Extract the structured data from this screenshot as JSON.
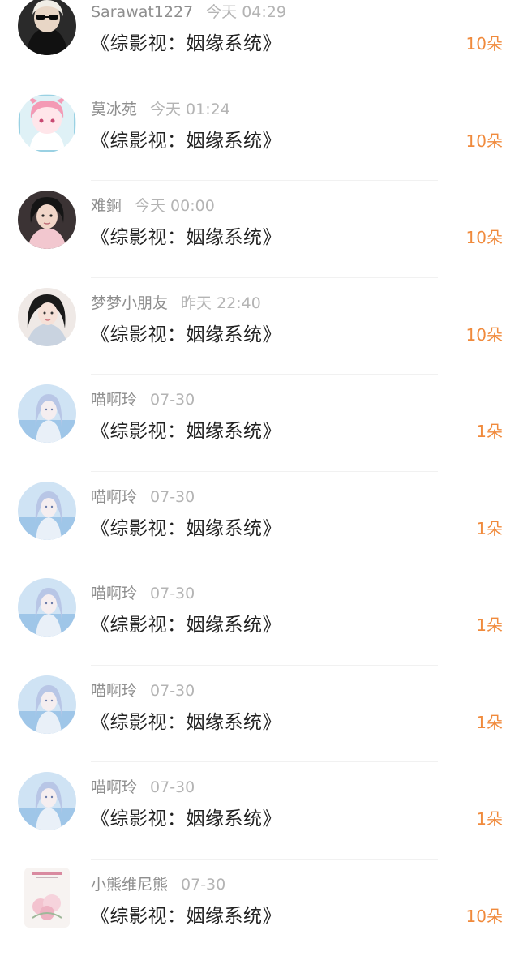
{
  "accent_color": "#f08a3c",
  "items": [
    {
      "name": "Sarawat1227",
      "time": "今天 04:29",
      "title": "《综影视：姻缘系统》",
      "gift": "10朵",
      "avatar": "dark-sunglasses-portrait"
    },
    {
      "name": "莫冰苑",
      "time": "今天 01:24",
      "title": "《综影视：姻缘系统》",
      "gift": "10朵",
      "avatar": "pink-anime-character"
    },
    {
      "name": "难錒",
      "time": "今天 00:00",
      "title": "《综影视：姻缘系统》",
      "gift": "10朵",
      "avatar": "girl-portrait-dark"
    },
    {
      "name": "梦梦小朋友",
      "time": "昨天 22:40",
      "title": "《综影视：姻缘系统》",
      "gift": "10朵",
      "avatar": "girl-portrait-light"
    },
    {
      "name": "喵啊玲",
      "time": "07-30",
      "title": "《综影视：姻缘系统》",
      "gift": "1朵",
      "avatar": "blue-anime-girl"
    },
    {
      "name": "喵啊玲",
      "time": "07-30",
      "title": "《综影视：姻缘系统》",
      "gift": "1朵",
      "avatar": "blue-anime-girl"
    },
    {
      "name": "喵啊玲",
      "time": "07-30",
      "title": "《综影视：姻缘系统》",
      "gift": "1朵",
      "avatar": "blue-anime-girl"
    },
    {
      "name": "喵啊玲",
      "time": "07-30",
      "title": "《综影视：姻缘系统》",
      "gift": "1朵",
      "avatar": "blue-anime-girl"
    },
    {
      "name": "喵啊玲",
      "time": "07-30",
      "title": "《综影视：姻缘系统》",
      "gift": "1朵",
      "avatar": "blue-anime-girl"
    },
    {
      "name": "小熊维尼熊",
      "time": "07-30",
      "title": "《综影视：姻缘系统》",
      "gift": "10朵",
      "avatar": "pink-flowers-card"
    }
  ]
}
